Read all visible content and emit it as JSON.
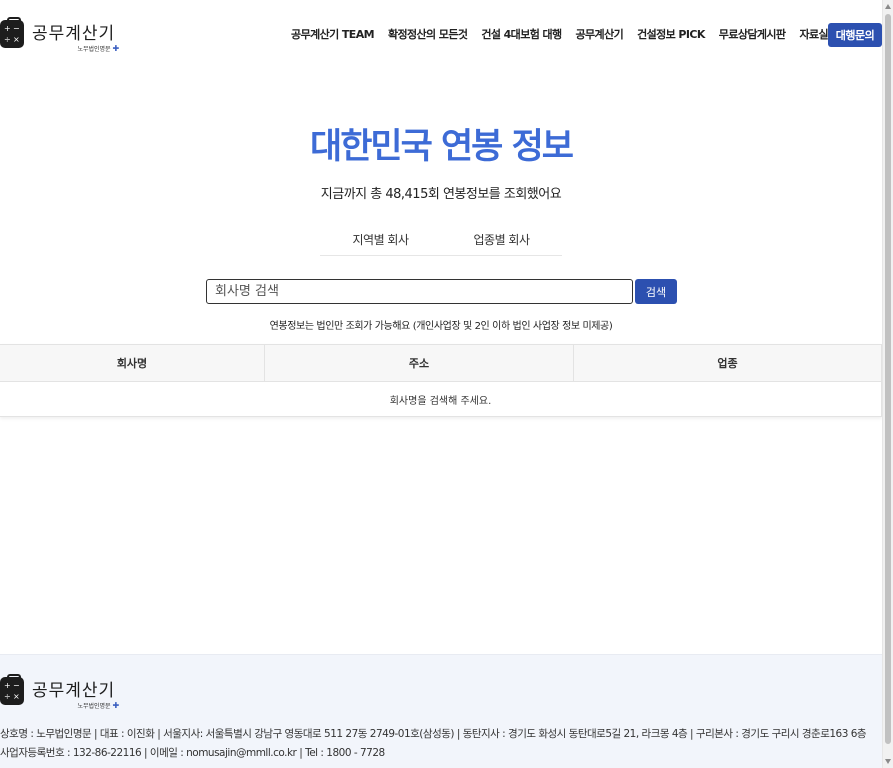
{
  "brand": {
    "logo_text": "공무계산기",
    "logo_sub": "노무법인명문"
  },
  "nav": {
    "items": [
      {
        "label": "공무계산기 TEAM",
        "name": "nav-team"
      },
      {
        "label": "확정정산의 모든것",
        "name": "nav-settlement"
      },
      {
        "label": "건설 4대보험 대행",
        "name": "nav-insurance"
      },
      {
        "label": "공무계산기",
        "name": "nav-calculator"
      },
      {
        "label": "건설정보 PICK",
        "name": "nav-pick"
      },
      {
        "label": "무료상담게시판",
        "name": "nav-consult-board"
      },
      {
        "label": "자료실",
        "name": "nav-archive"
      }
    ],
    "cta_label": "대행문의"
  },
  "hero": {
    "title": "대한민국 연봉 정보",
    "subtitle": "지금까지 총 48,415회 연봉정보를 조회했어요"
  },
  "tabs": [
    {
      "label": "지역별 회사"
    },
    {
      "label": "업종별 회사"
    }
  ],
  "search": {
    "placeholder": "회사명 검색",
    "button_label": "검색",
    "notice": "연봉정보는 법인만 조회가 가능해요 (개인사업장 및 2인 이하 법인 사업장 정보 미제공)"
  },
  "table": {
    "columns": [
      "회사명",
      "주소",
      "업종"
    ],
    "empty_message": "회사명을 검색해 주세요."
  },
  "footer": {
    "line1": "상호명 : 노무법인명문  |  대표 : 이진화  |  서울지사: 서울특별시 강남구 영동대로 511 27동 2749-01호(삼성동)  |  동탄지사 : 경기도 화성시 동탄대로5길 21, 라크몽 4층  |  구리본사 : 경기도 구리시 경춘로163 6층",
    "line2": "사업자등록번호 : 132-86-22116  |  이메일 : nomusajin@mmll.co.kr  |  Tel : 1800 - 7728"
  },
  "colors": {
    "accent": "#3d6bd6",
    "button": "#2c50b0",
    "footer_bg": "#f2f5fb"
  }
}
